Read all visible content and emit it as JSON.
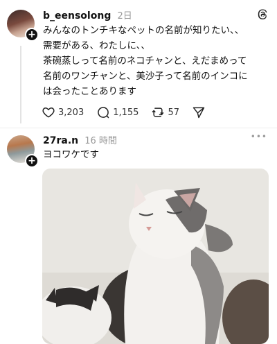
{
  "post1": {
    "username": "b_eensolong",
    "time": "2日",
    "lines": [
      "みんなのトンチキなペットの名前が知りたい、、",
      "需要がある、わたしに、、",
      "茶碗蒸しって名前のネコチャンと、えだまめって",
      "名前のワンチャンと、美沙子って名前のインコに",
      "は会ったことあります"
    ],
    "likes": "3,203",
    "comments": "1,155",
    "reposts": "57"
  },
  "post2": {
    "username": "27ra.n",
    "time": "16 時間",
    "text": "ヨコワケです",
    "more": "•••"
  }
}
